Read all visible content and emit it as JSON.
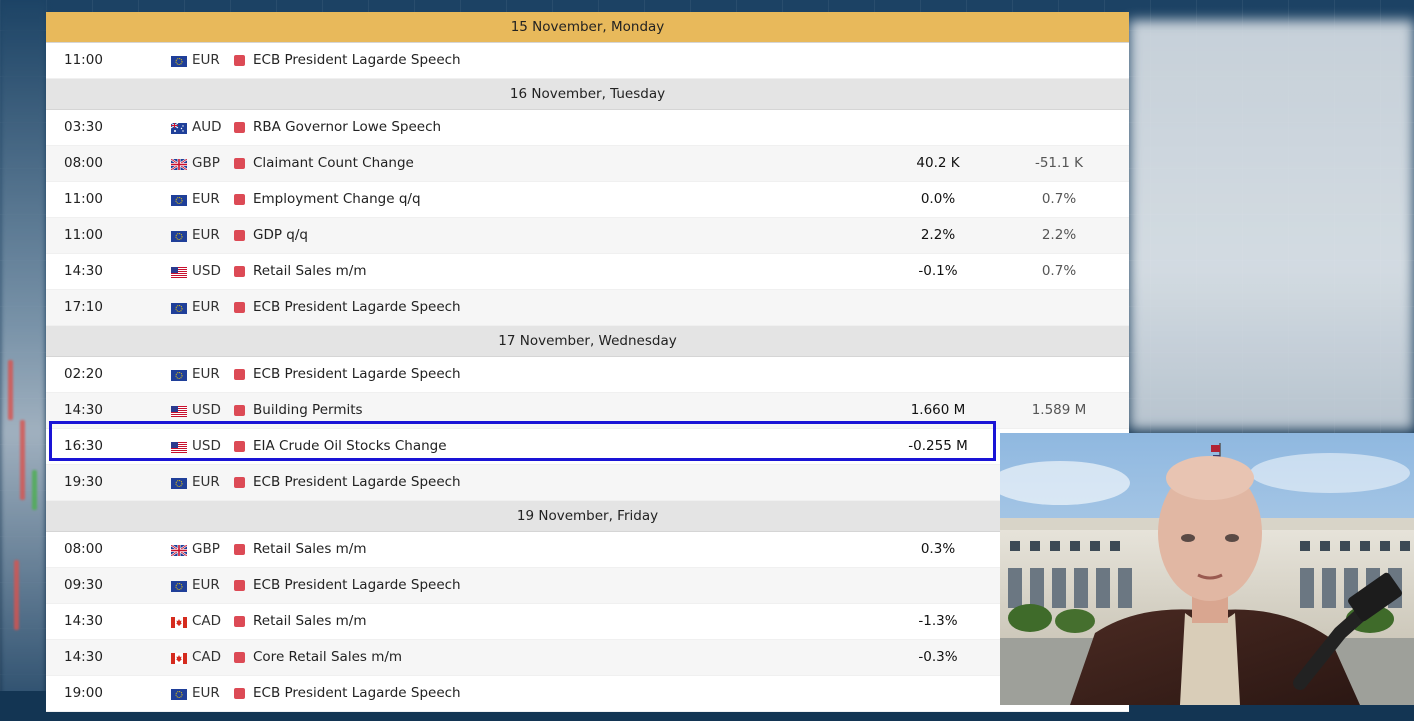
{
  "calendar": {
    "days": [
      {
        "header": "15 November, Monday",
        "events": [
          {
            "time": "11:00",
            "flag": "eu-flag-icon",
            "currency": "EUR",
            "event": "ECB President Lagarde Speech",
            "actual": "",
            "forecast": ""
          }
        ]
      },
      {
        "header": "16 November, Tuesday",
        "events": [
          {
            "time": "03:30",
            "flag": "au-flag-icon",
            "currency": "AUD",
            "event": "RBA Governor Lowe Speech",
            "actual": "",
            "forecast": ""
          },
          {
            "time": "08:00",
            "flag": "gb-flag-icon",
            "currency": "GBP",
            "event": "Claimant Count Change",
            "actual": "40.2 K",
            "forecast": "-51.1 K"
          },
          {
            "time": "11:00",
            "flag": "eu-flag-icon",
            "currency": "EUR",
            "event": "Employment Change q/q",
            "actual": "0.0%",
            "forecast": "0.7%"
          },
          {
            "time": "11:00",
            "flag": "eu-flag-icon",
            "currency": "EUR",
            "event": "GDP q/q",
            "actual": "2.2%",
            "forecast": "2.2%"
          },
          {
            "time": "14:30",
            "flag": "us-flag-icon",
            "currency": "USD",
            "event": "Retail Sales m/m",
            "actual": "-0.1%",
            "forecast": "0.7%"
          },
          {
            "time": "17:10",
            "flag": "eu-flag-icon",
            "currency": "EUR",
            "event": "ECB President Lagarde Speech",
            "actual": "",
            "forecast": ""
          }
        ]
      },
      {
        "header": "17 November, Wednesday",
        "events": [
          {
            "time": "02:20",
            "flag": "eu-flag-icon",
            "currency": "EUR",
            "event": "ECB President Lagarde Speech",
            "actual": "",
            "forecast": ""
          },
          {
            "time": "14:30",
            "flag": "us-flag-icon",
            "currency": "USD",
            "event": "Building Permits",
            "actual": "1.660 M",
            "forecast": "1.589 M"
          },
          {
            "time": "16:30",
            "flag": "us-flag-icon",
            "currency": "USD",
            "event": "EIA Crude Oil Stocks Change",
            "actual": "-0.255 M",
            "forecast": ""
          },
          {
            "time": "19:30",
            "flag": "eu-flag-icon",
            "currency": "EUR",
            "event": "ECB President Lagarde Speech",
            "actual": "",
            "forecast": ""
          }
        ]
      },
      {
        "header": "19 November, Friday",
        "events": [
          {
            "time": "08:00",
            "flag": "gb-flag-icon",
            "currency": "GBP",
            "event": "Retail Sales m/m",
            "actual": "0.3%",
            "forecast": ""
          },
          {
            "time": "09:30",
            "flag": "eu-flag-icon",
            "currency": "EUR",
            "event": "ECB President Lagarde Speech",
            "actual": "",
            "forecast": ""
          },
          {
            "time": "14:30",
            "flag": "ca-flag-icon",
            "currency": "CAD",
            "event": "Retail Sales m/m",
            "actual": "-1.3%",
            "forecast": ""
          },
          {
            "time": "14:30",
            "flag": "ca-flag-icon",
            "currency": "CAD",
            "event": "Core Retail Sales m/m",
            "actual": "-0.3%",
            "forecast": ""
          },
          {
            "time": "19:00",
            "flag": "eu-flag-icon",
            "currency": "EUR",
            "event": "ECB President Lagarde Speech",
            "actual": "",
            "forecast": ""
          }
        ]
      }
    ],
    "highlighted_event": "EIA Crude Oil Stocks Change"
  },
  "colors": {
    "first_header": "#e8b95b",
    "day_header": "#e4e4e4",
    "impact_high": "#dc4a55",
    "highlight_border": "#1a14d6"
  }
}
